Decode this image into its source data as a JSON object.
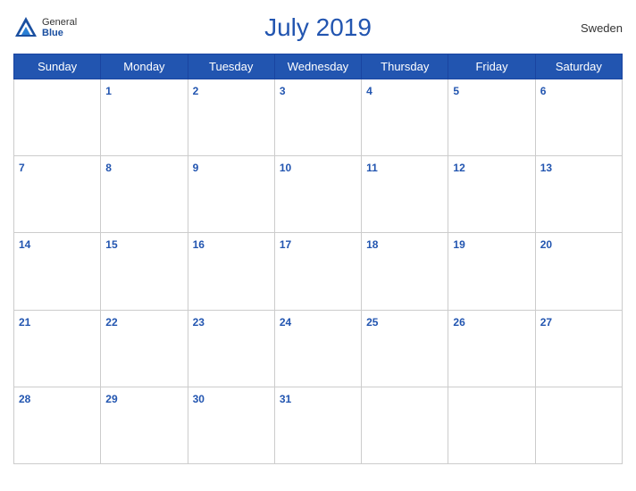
{
  "header": {
    "title": "July 2019",
    "country": "Sweden",
    "logo": {
      "general": "General",
      "blue": "Blue"
    }
  },
  "days_of_week": [
    "Sunday",
    "Monday",
    "Tuesday",
    "Wednesday",
    "Thursday",
    "Friday",
    "Saturday"
  ],
  "weeks": [
    [
      null,
      1,
      2,
      3,
      4,
      5,
      6
    ],
    [
      7,
      8,
      9,
      10,
      11,
      12,
      13
    ],
    [
      14,
      15,
      16,
      17,
      18,
      19,
      20
    ],
    [
      21,
      22,
      23,
      24,
      25,
      26,
      27
    ],
    [
      28,
      29,
      30,
      31,
      null,
      null,
      null
    ]
  ]
}
